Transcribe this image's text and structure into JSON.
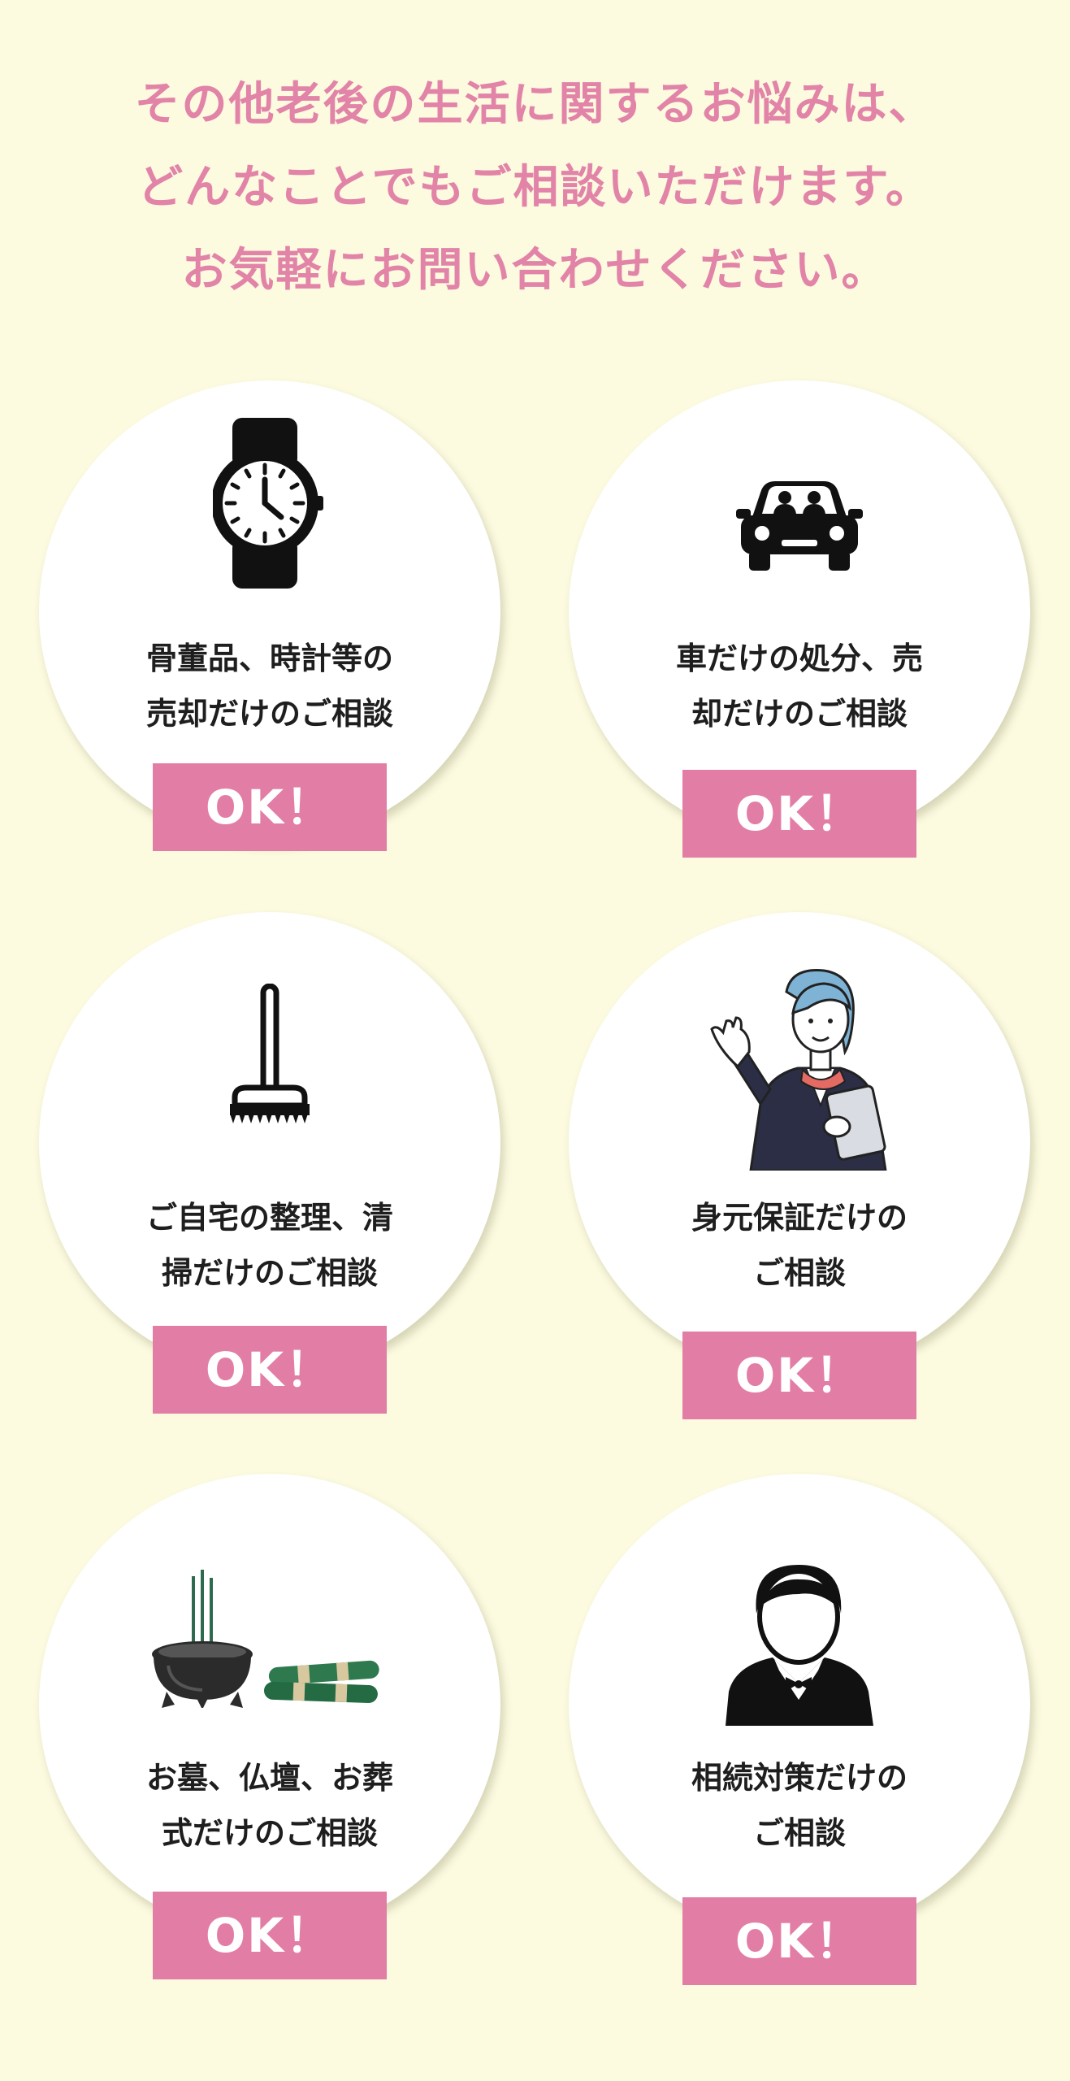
{
  "headline": {
    "line1": "その他老後の生活に関するお悩みは、",
    "line2": "どんなことでもご相談いただけます。",
    "line3": "お気軽にお問い合わせください。"
  },
  "colors": {
    "background": "#FCFADF",
    "accent_pink": "#E27EA5",
    "headline_pink": "#E283A8"
  },
  "cards": [
    {
      "icon": "wristwatch-icon",
      "line1": "骨董品、時計等の",
      "line2": "売却だけのご相談",
      "badge": "OK！"
    },
    {
      "icon": "car-icon",
      "line1": "車だけの処分、売",
      "line2": "却だけのご相談",
      "badge": "OK！"
    },
    {
      "icon": "broom-icon",
      "line1": "ご自宅の整理、清",
      "line2": "掃だけのご相談",
      "badge": "OK！"
    },
    {
      "icon": "receptionist-woman-icon",
      "line1": "身元保証だけの",
      "line2": "ご相談",
      "badge": "OK！"
    },
    {
      "icon": "incense-burner-icon",
      "line1": "お墓、仏壇、お葬",
      "line2": "式だけのご相談",
      "badge": "OK！"
    },
    {
      "icon": "businessman-icon",
      "line1": "相続対策だけの",
      "line2": "ご相談",
      "badge": "OK！"
    }
  ]
}
